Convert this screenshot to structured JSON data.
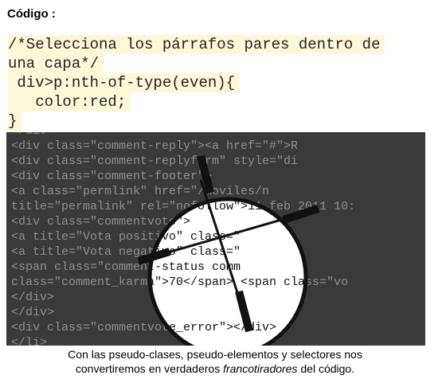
{
  "heading": "Código :",
  "code_lines": [
    "/*Selecciona los párrafos pares dentro de",
    "una capa*/",
    " div>p:nth-of-type(even){",
    "   color:red;",
    "}"
  ],
  "image_code_lines": [
    "        </div>",
    "      <div class=\"comment-reply\"><a href=\"#\">R",
    "      <div class=\"comment-replyform\" style=\"di",
    "      <div class=\"comment-footer\">",
    "        <a class=\"permlink\" href=\"/moviles/n",
    "title=\"permalink\" rel=\"nofollow\">11 feb 2011 10:",
    "        <div class=\"commentvote\">",
    "          <a title=\"Vota positivo\" class=\"",
    "          <a title=\"Vota negativo\" class=\"",
    "          <span class=\"comment-status comm",
    "class=\"comment_karma\">70</span> <span class=\"vo",
    "        </div>",
    "      </div>",
    "      <div class=\"commentvote_error\"></div>",
    "    </li>"
  ],
  "caption": {
    "line1": "Con las pseudo-clases, pseudo-elementos y selectores nos",
    "line2_before": "convertiremos en verdaderos ",
    "line2_em": "francotiradores",
    "line2_after": " del código."
  },
  "colors": {
    "highlight": "#fdf9d8",
    "photo_background": "#3a3a3a",
    "scope_lens": "#ffffff"
  }
}
